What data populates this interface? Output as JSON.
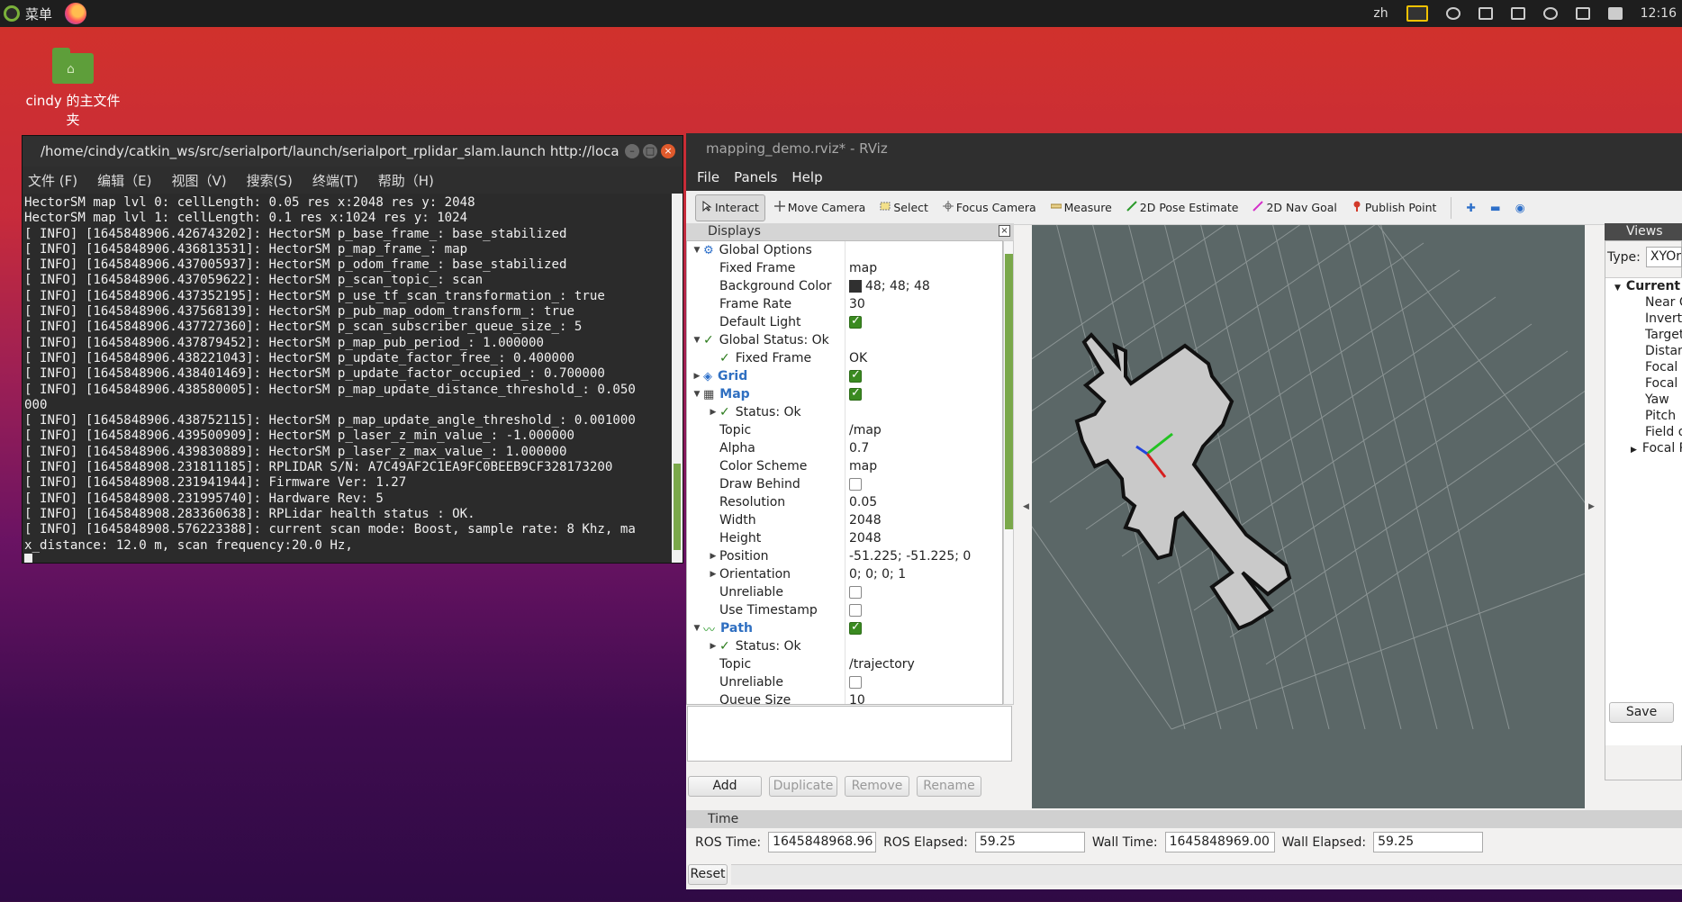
{
  "top_panel": {
    "menu_label": "菜单",
    "lang": "zh",
    "clock": "12:16"
  },
  "desktop": {
    "home_icon_label": "cindy 的主文件夹"
  },
  "terminal": {
    "title": "/home/cindy/catkin_ws/src/serialport/launch/serialport_rplidar_slam.launch http://loca",
    "menu": [
      "文件 (F)",
      "编辑（E)",
      "视图（V)",
      "搜索(S)",
      "终端(T)",
      "帮助（H)"
    ],
    "lines": [
      "HectorSM map lvl 0: cellLength: 0.05 res x:2048 res y: 2048",
      "HectorSM map lvl 1: cellLength: 0.1 res x:1024 res y: 1024",
      "[ INFO] [1645848906.426743202]: HectorSM p_base_frame_: base_stabilized",
      "[ INFO] [1645848906.436813531]: HectorSM p_map_frame_: map",
      "[ INFO] [1645848906.437005937]: HectorSM p_odom_frame_: base_stabilized",
      "[ INFO] [1645848906.437059622]: HectorSM p_scan_topic_: scan",
      "[ INFO] [1645848906.437352195]: HectorSM p_use_tf_scan_transformation_: true",
      "[ INFO] [1645848906.437568139]: HectorSM p_pub_map_odom_transform_: true",
      "[ INFO] [1645848906.437727360]: HectorSM p_scan_subscriber_queue_size_: 5",
      "[ INFO] [1645848906.437879452]: HectorSM p_map_pub_period_: 1.000000",
      "[ INFO] [1645848906.438221043]: HectorSM p_update_factor_free_: 0.400000",
      "[ INFO] [1645848906.438401469]: HectorSM p_update_factor_occupied_: 0.700000",
      "[ INFO] [1645848906.438580005]: HectorSM p_map_update_distance_threshold_: 0.050",
      "000",
      "[ INFO] [1645848906.438752115]: HectorSM p_map_update_angle_threshold_: 0.001000",
      "[ INFO] [1645848906.439500909]: HectorSM p_laser_z_min_value_: -1.000000",
      "[ INFO] [1645848906.439830889]: HectorSM p_laser_z_max_value_: 1.000000",
      "[ INFO] [1645848908.231811185]: RPLIDAR S/N: A7C49AF2C1EA9FC0BEEB9CF328173200",
      "[ INFO] [1645848908.231941944]: Firmware Ver: 1.27",
      "[ INFO] [1645848908.231995740]: Hardware Rev: 5",
      "[ INFO] [1645848908.283360638]: RPLidar health status : OK.",
      "[ INFO] [1645848908.576223388]: current scan mode: Boost, sample rate: 8 Khz, ma",
      "x_distance: 12.0 m, scan frequency:20.0 Hz,"
    ]
  },
  "rviz": {
    "title": "mapping_demo.rviz* - RViz",
    "menu": [
      "File",
      "Panels",
      "Help"
    ],
    "tools": [
      {
        "label": "Interact",
        "icon": "cursor-icon",
        "active": true
      },
      {
        "label": "Move Camera",
        "icon": "move-camera-icon"
      },
      {
        "label": "Select",
        "icon": "select-icon"
      },
      {
        "label": "Focus Camera",
        "icon": "focus-camera-icon"
      },
      {
        "label": "Measure",
        "icon": "ruler-icon"
      },
      {
        "label": "2D Pose Estimate",
        "icon": "green-arrow-icon"
      },
      {
        "label": "2D Nav Goal",
        "icon": "pink-arrow-icon"
      },
      {
        "label": "Publish Point",
        "icon": "map-pin-icon"
      }
    ],
    "displays_title": "Displays",
    "displays": [
      {
        "indent": 0,
        "arrow": "▼",
        "icon": "gear-icon",
        "name": "Global Options",
        "value": ""
      },
      {
        "indent": 1,
        "name": "Fixed Frame",
        "value": "map"
      },
      {
        "indent": 1,
        "name": "Background Color",
        "value": "48; 48; 48",
        "swatch": "#303030"
      },
      {
        "indent": 1,
        "name": "Frame Rate",
        "value": "30"
      },
      {
        "indent": 1,
        "name": "Default Light",
        "check": true
      },
      {
        "indent": 0,
        "arrow": "▼",
        "ok": true,
        "name": "Global Status: Ok",
        "value": ""
      },
      {
        "indent": 1,
        "ok": true,
        "name": "Fixed Frame",
        "value": "OK"
      },
      {
        "indent": 0,
        "arrow": "▶",
        "icon": "grid-icon",
        "name": "Grid",
        "blue": true,
        "check": true
      },
      {
        "indent": 0,
        "arrow": "▼",
        "icon": "map-icon",
        "name": "Map",
        "blue": true,
        "check": true
      },
      {
        "indent": 1,
        "arrow": "▶",
        "ok": true,
        "name": "Status: Ok",
        "value": ""
      },
      {
        "indent": 1,
        "name": "Topic",
        "value": "/map"
      },
      {
        "indent": 1,
        "name": "Alpha",
        "value": "0.7"
      },
      {
        "indent": 1,
        "name": "Color Scheme",
        "value": "map"
      },
      {
        "indent": 1,
        "name": "Draw Behind",
        "check": false
      },
      {
        "indent": 1,
        "name": "Resolution",
        "value": "0.05"
      },
      {
        "indent": 1,
        "name": "Width",
        "value": "2048"
      },
      {
        "indent": 1,
        "name": "Height",
        "value": "2048"
      },
      {
        "indent": 1,
        "arrow": "▶",
        "name": "Position",
        "value": "-51.225; -51.225; 0"
      },
      {
        "indent": 1,
        "arrow": "▶",
        "name": "Orientation",
        "value": "0; 0; 0; 1"
      },
      {
        "indent": 1,
        "name": "Unreliable",
        "check": false
      },
      {
        "indent": 1,
        "name": "Use Timestamp",
        "check": false
      },
      {
        "indent": 0,
        "arrow": "▼",
        "icon": "path-icon",
        "name": "Path",
        "blue": true,
        "check": true
      },
      {
        "indent": 1,
        "arrow": "▶",
        "ok": true,
        "name": "Status: Ok",
        "value": ""
      },
      {
        "indent": 1,
        "name": "Topic",
        "value": "/trajectory"
      },
      {
        "indent": 1,
        "name": "Unreliable",
        "check": false
      },
      {
        "indent": 1,
        "name": "Queue Size",
        "value": "10"
      }
    ],
    "buttons": {
      "add": "Add",
      "duplicate": "Duplicate",
      "remove": "Remove",
      "rename": "Rename"
    },
    "views": {
      "title": "Views",
      "type_label": "Type:",
      "type_value": "XYOr",
      "current": "Current V",
      "items": [
        "Near C",
        "Invert",
        "Target",
        "Distan",
        "Focal S",
        "Focal S",
        "Yaw",
        "Pitch",
        "Field o"
      ],
      "last_item": "Focal P",
      "save": "Save"
    },
    "time": {
      "title": "Time",
      "ros_time_label": "ROS Time:",
      "ros_time": "1645848968.96",
      "ros_elapsed_label": "ROS Elapsed:",
      "ros_elapsed": "59.25",
      "wall_time_label": "Wall Time:",
      "wall_time": "1645848969.00",
      "wall_elapsed_label": "Wall Elapsed:",
      "wall_elapsed": "59.25",
      "reset": "Reset"
    }
  }
}
